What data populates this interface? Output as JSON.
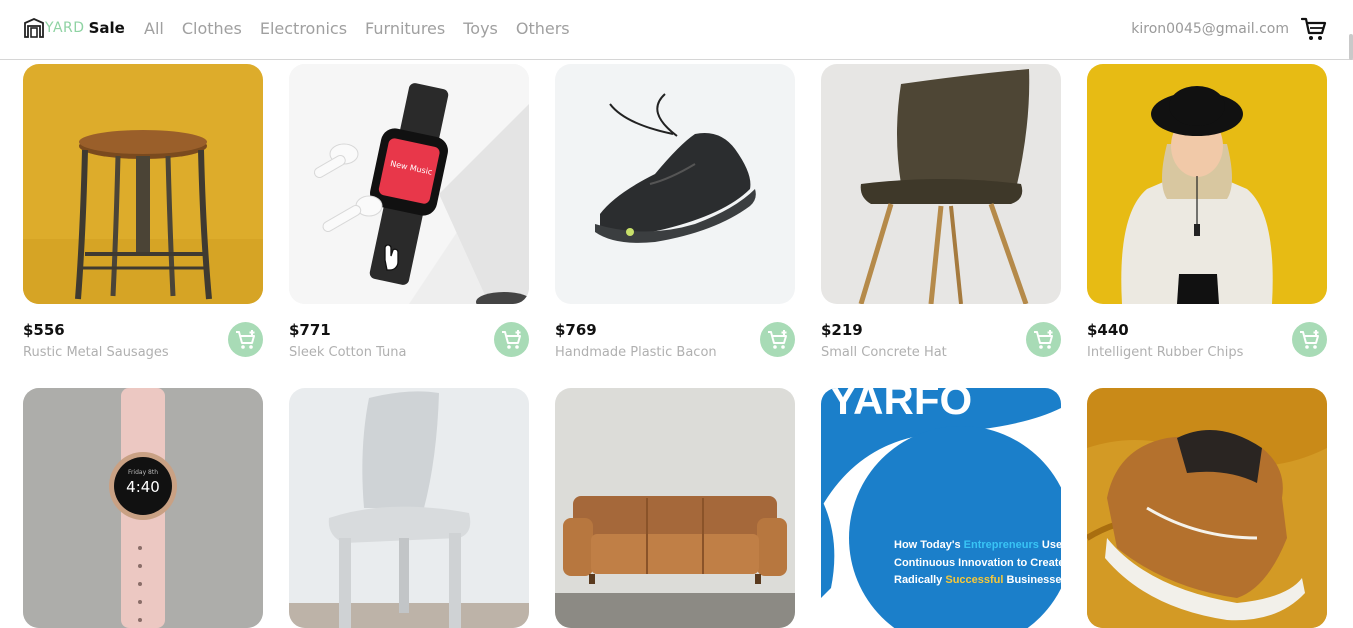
{
  "brand": {
    "yard": "YARD",
    "sale": "Sale"
  },
  "nav": {
    "categories": [
      "All",
      "Clothes",
      "Electronics",
      "Furnitures",
      "Toys",
      "Others"
    ]
  },
  "user": {
    "email": "kiron0045@gmail.com"
  },
  "colors": {
    "accent": "#a8dbb6",
    "logo_green": "#8fd3a3",
    "muted_text": "#b0b0b0"
  },
  "products": [
    {
      "price": "$556",
      "name": "Rustic Metal Sausages",
      "image": "wooden-stool"
    },
    {
      "price": "$771",
      "name": "Sleek Cotton Tuna",
      "image": "smartwatch-airpods",
      "watch_screen": "New Music"
    },
    {
      "price": "$769",
      "name": "Handmade Plastic Bacon",
      "image": "black-sneaker"
    },
    {
      "price": "$219",
      "name": "Small Concrete Hat",
      "image": "brown-chair"
    },
    {
      "price": "$440",
      "name": "Intelligent Rubber Chips",
      "image": "woman-hat"
    },
    {
      "image": "pink-smartwatch",
      "watch_day": "Friday 8th",
      "watch_time": "4:40"
    },
    {
      "image": "white-chair"
    },
    {
      "image": "leather-sofa"
    },
    {
      "image": "book-cover",
      "cover_title": "YARFO",
      "cover_line1_a": "How Today's ",
      "cover_line1_b": "Entrepreneurs",
      "cover_line1_c": " Use",
      "cover_line2": "Continuous Innovation to Create",
      "cover_line3_a": "Radically ",
      "cover_line3_b": "Successful",
      "cover_line3_c": " Businesses"
    },
    {
      "image": "brown-sneaker"
    }
  ]
}
